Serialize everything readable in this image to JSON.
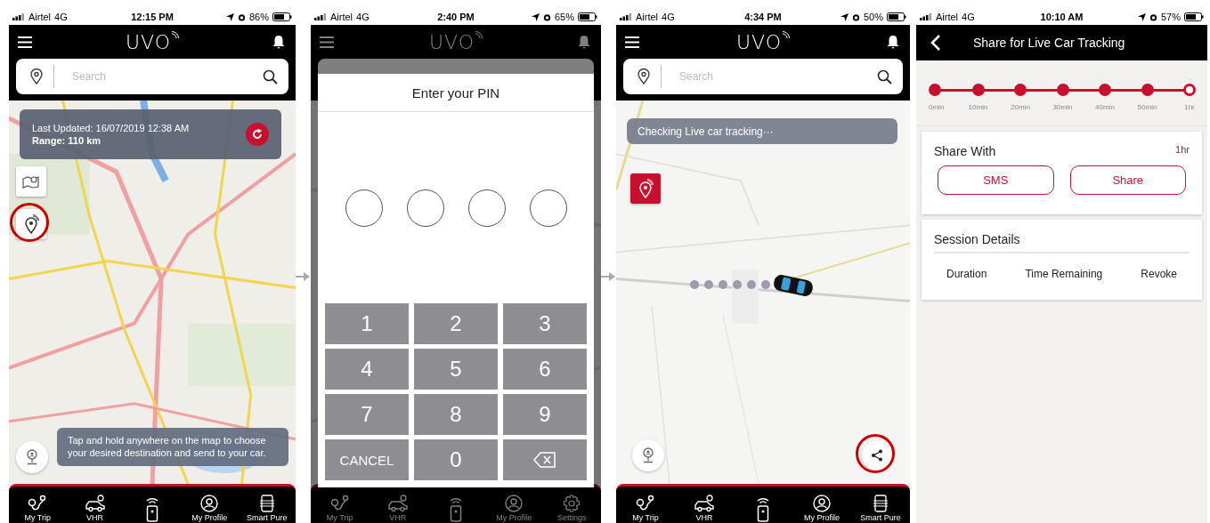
{
  "screens": [
    {
      "kind": "map",
      "status": {
        "carrier": "Airtel",
        "network": "4G",
        "time": "12:15 PM",
        "battery": "86%"
      },
      "header": {
        "logo": "UVO"
      },
      "search": {
        "placeholder": "Search"
      },
      "info_card": {
        "updated": "Last Updated: 16/07/2019 12:38 AM",
        "range": "Range: 110 km"
      },
      "map_buttons": [
        {
          "kind": "layers",
          "circled": false
        },
        {
          "kind": "tracking",
          "circled": true
        }
      ],
      "hint": "Tap and hold anywhere on the map to choose your desired destination and send to your car.",
      "nav": [
        {
          "kind": "trip",
          "label": "My Trip"
        },
        {
          "kind": "car",
          "label": "VHR"
        },
        {
          "kind": "remote"
        },
        {
          "kind": "profile",
          "label": "My Profile"
        },
        {
          "kind": "purifier",
          "label": "Smart Pure"
        }
      ]
    },
    {
      "kind": "pin",
      "status": {
        "carrier": "Airtel",
        "network": "4G",
        "time": "2:40 PM",
        "battery": "65%"
      },
      "header": {
        "logo": "UVO"
      },
      "dialog": {
        "title": "Enter your PIN",
        "slots": [
          {
            "filled": false
          },
          {
            "filled": false
          },
          {
            "filled": false
          },
          {
            "filled": false
          }
        ],
        "keys": [
          {
            "kind": "text",
            "label": "1"
          },
          {
            "kind": "text",
            "label": "2"
          },
          {
            "kind": "text",
            "label": "3"
          },
          {
            "kind": "text",
            "label": "4"
          },
          {
            "kind": "text",
            "label": "5"
          },
          {
            "kind": "text",
            "label": "6"
          },
          {
            "kind": "text",
            "label": "7"
          },
          {
            "kind": "text",
            "label": "8"
          },
          {
            "kind": "text",
            "label": "9"
          },
          {
            "kind": "text",
            "label": "CANCEL"
          },
          {
            "kind": "text",
            "label": "0"
          },
          {
            "kind": "backspace"
          }
        ]
      },
      "nav": [
        {
          "kind": "trip",
          "label": "My Trip"
        },
        {
          "kind": "car",
          "label": "VHR"
        },
        {
          "kind": "remote"
        },
        {
          "kind": "profile",
          "label": "My Profile"
        },
        {
          "kind": "gear",
          "label": "Settings"
        }
      ]
    },
    {
      "kind": "tracking",
      "status": {
        "carrier": "Airtel",
        "network": "4G",
        "time": "4:34 PM",
        "battery": "50%"
      },
      "header": {
        "logo": "UVO"
      },
      "search": {
        "placeholder": "Search"
      },
      "toast": "Checking Live car tracking···",
      "map_buttons": [
        {
          "kind": "tracking_active",
          "circled": false
        }
      ],
      "share_button": {
        "circled": true
      },
      "nav": [
        {
          "kind": "trip",
          "label": "My Trip"
        },
        {
          "kind": "car",
          "label": "VHR"
        },
        {
          "kind": "remote"
        },
        {
          "kind": "profile",
          "label": "My Profile"
        },
        {
          "kind": "purifier",
          "label": "Smart Pure"
        }
      ]
    },
    {
      "kind": "share",
      "status": {
        "carrier": "Airtel",
        "network": "4G",
        "time": "10:10 AM",
        "battery": "57%"
      },
      "title": "Share for Live Car Tracking",
      "timeline": {
        "stops": [
          {
            "label": "0min",
            "selected": false
          },
          {
            "label": "10min",
            "selected": false
          },
          {
            "label": "20min",
            "selected": false
          },
          {
            "label": "30min",
            "selected": false
          },
          {
            "label": "40min",
            "selected": false
          },
          {
            "label": "50min",
            "selected": false
          },
          {
            "label": "1hr",
            "selected": true
          }
        ]
      },
      "share_card": {
        "title": "Share With",
        "duration": "1hr",
        "buttons": [
          "SMS",
          "Share"
        ]
      },
      "session_card": {
        "title": "Session Details",
        "columns": [
          "Duration",
          "Time Remaining",
          "Revoke"
        ]
      }
    }
  ]
}
